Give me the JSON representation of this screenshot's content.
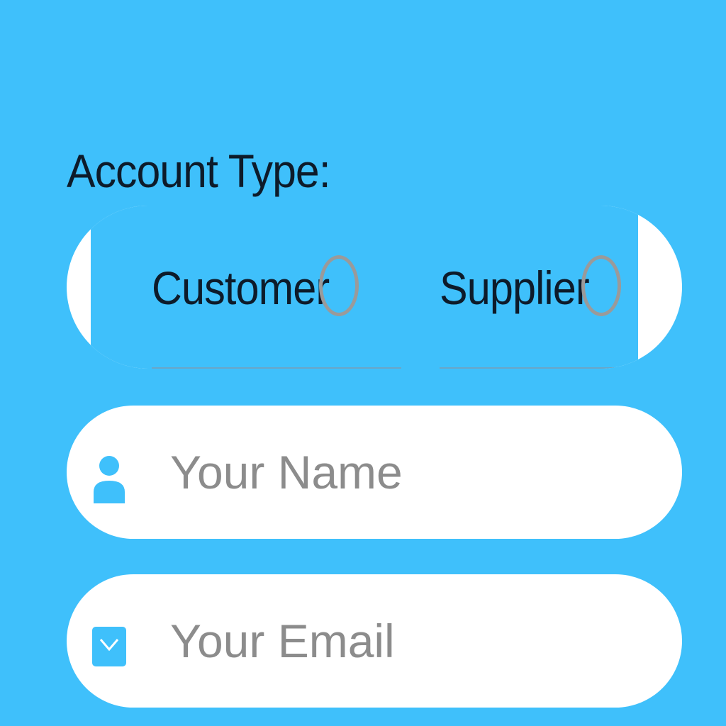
{
  "form": {
    "account_type_label": "Account Type:",
    "account_options": [
      {
        "label": "Customer",
        "selected": false
      },
      {
        "label": "Supplier",
        "selected": false
      }
    ],
    "name_field": {
      "placeholder": "Your Name",
      "value": "",
      "icon": "person-icon"
    },
    "email_field": {
      "placeholder": "Your Email",
      "value": "",
      "icon": "envelope-icon"
    }
  },
  "colors": {
    "background": "#3fc0fb",
    "field_background": "#ffffff",
    "icon": "#3fc0fb",
    "radio_border": "#9a9a9a",
    "text": "#0d1b2a",
    "placeholder": "#8c8c8c"
  }
}
